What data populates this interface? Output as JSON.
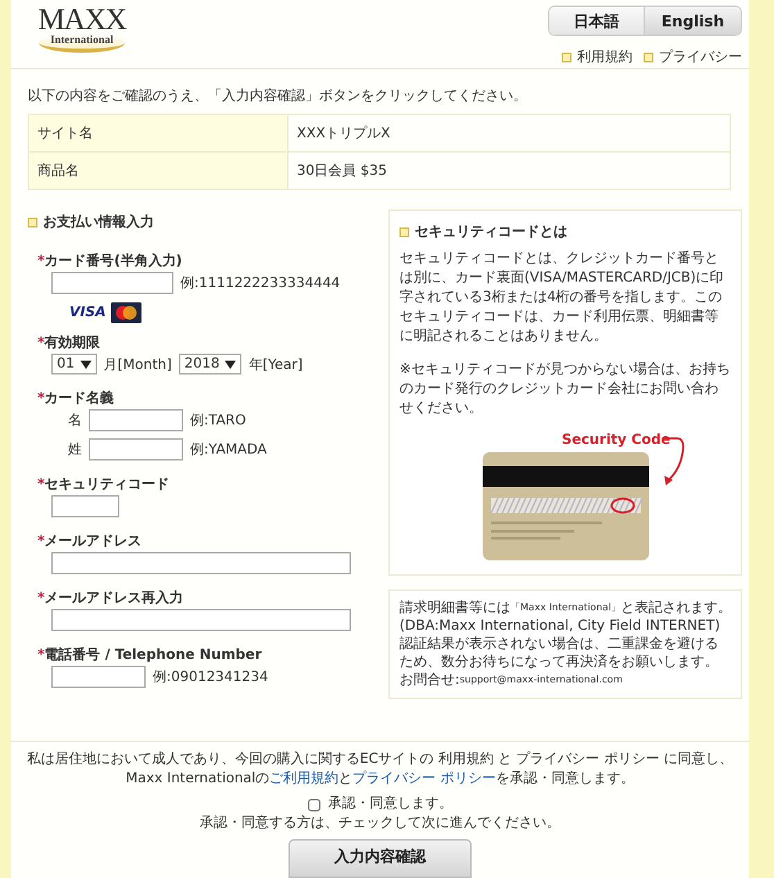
{
  "header": {
    "logo": {
      "wordmark": "MAXX",
      "subtitle": "International"
    },
    "languages": [
      {
        "label": "日本語",
        "selected": true
      },
      {
        "label": "English",
        "selected": false
      }
    ],
    "links": [
      "利用規約",
      "プライバシー"
    ]
  },
  "intro": "以下の内容をご確認のうえ、「入力内容確認」ボタンをクリックしてください。",
  "summary": [
    {
      "label": "サイト名",
      "value": "XXXトリプルX"
    },
    {
      "label": "商品名",
      "value": "30日会員 $35"
    }
  ],
  "payment": {
    "title": "お支払い情報入力",
    "fields": [
      {
        "kind": "card",
        "star": "*",
        "label": "カード番号(半角入力)",
        "example": "例:1111222233334444",
        "brand": "VISA"
      },
      {
        "kind": "expiry",
        "star": "*",
        "label": "有効期限",
        "selects": [
          {
            "value": "01",
            "unit": "月[Month]"
          },
          {
            "value": "2018",
            "unit": "年[Year]"
          }
        ]
      },
      {
        "kind": "name",
        "star": "*",
        "label": "カード名義",
        "rows": [
          {
            "label": "名",
            "example": "例:TARO"
          },
          {
            "label": "姓",
            "example": "例:YAMADA"
          }
        ]
      },
      {
        "kind": "short",
        "star": "*",
        "label": "セキュリティコード"
      },
      {
        "kind": "long",
        "star": "*",
        "label": "メールアドレス"
      },
      {
        "kind": "long",
        "star": "*",
        "label": "メールアドレス再入力"
      },
      {
        "kind": "text",
        "star": "*",
        "label": "電話番号 / Telephone Number",
        "example": "例:09012341234"
      }
    ]
  },
  "security_info": {
    "title": "セキュリティコードとは",
    "paragraphs": [
      "セキュリティコードとは、クレジットカード番号とは別に、カード裏面(VISA/MASTERCARD/JCB)に印字されている3桁または4桁の番号を指します。このセキュリティコードは、カード利用伝票、明細書等に明記されることはありません。",
      "※セキュリティコードが見つからない場合は、お持ちのカード発行のクレジットカード会社にお問い合わせください。"
    ],
    "callout": "Security Code"
  },
  "billing_info": {
    "descriptor": {
      "before": "請求明細書等には",
      "small": "「Maxx International」",
      "after": "と表記されます。"
    },
    "dba": "(DBA:Maxx International, City Field INTERNET)",
    "notice": "認証結果が表示されない場合は、二重課金を避けるため、数分お待ちになって再決済をお願いします。",
    "contact": {
      "label": "お問合せ:",
      "email": "support@maxx-international.com"
    }
  },
  "agreement": {
    "lines": [
      [
        {
          "text": "私は居住地において成人であり、今回の購入に関するECサイトの 利用規約 と プライバシー ポリシー に同意し、",
          "kind": "text"
        }
      ],
      [
        {
          "text": "Maxx Internationalの",
          "kind": "text"
        },
        {
          "text": "ご利用規約",
          "kind": "link"
        },
        {
          "text": "と",
          "kind": "text"
        },
        {
          "text": "プライバシー ポリシー",
          "kind": "link"
        },
        {
          "text": "を承認・同意します。",
          "kind": "text"
        }
      ]
    ],
    "checkbox": {
      "label": "承認・同意します。",
      "checked": false
    },
    "note": "承認・同意する方は、チェックして次に進んでください。",
    "button": "入力内容確認"
  }
}
